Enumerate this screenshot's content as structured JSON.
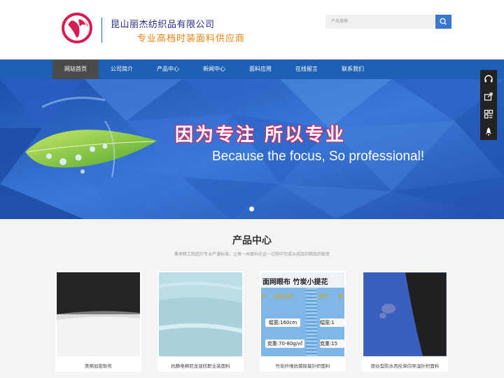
{
  "header": {
    "company_name": "昆山丽杰纺织品有限公司",
    "slogan": "专业高档时装面料供应商",
    "search_placeholder": "产品搜索"
  },
  "nav": {
    "items": [
      "网站首页",
      "公司简介",
      "产品中心",
      "新闻中心",
      "面料应用",
      "在线留言",
      "联系我们"
    ],
    "active": "网站首页"
  },
  "banner": {
    "headline_cn": "因为专注 所以专业",
    "headline_en": "Because the focus, So professional!"
  },
  "side_toolbar": {
    "icons": [
      "headset-icon",
      "share-icon",
      "qrcode-icon",
      "rocket-icon"
    ]
  },
  "products_section": {
    "title": "产品中心",
    "subtitle": "秉承精工制造的专业严谨标准，让每一米面料在这一过程中完成从成品到精品的蜕变",
    "items": [
      {
        "name": "美棉加密斩布"
      },
      {
        "name": "抗静电棉尼龙混纺职业装面料"
      },
      {
        "name": "竹炭纤维抗菌除臭针织面料"
      },
      {
        "name": "原纱型防水丙纶单向导湿针织面料"
      }
    ],
    "item3_image_text": {
      "line1": "面网眼布   竹炭小提花",
      "line2a": "气",
      "line2b": "柔软丝滑",
      "line2c": "速干透气",
      "line2d": "柔",
      "width_a": "幅宽:160cm",
      "width_b": "幅宽:1",
      "weight_a": "克重:70-80g/㎡",
      "weight_b": "克重:15"
    }
  },
  "colors": {
    "nav_blue": "#1c5fb4",
    "nav_active": "#4a4a4a",
    "search_button": "#3b76cf",
    "slogan_orange": "#e88412"
  }
}
